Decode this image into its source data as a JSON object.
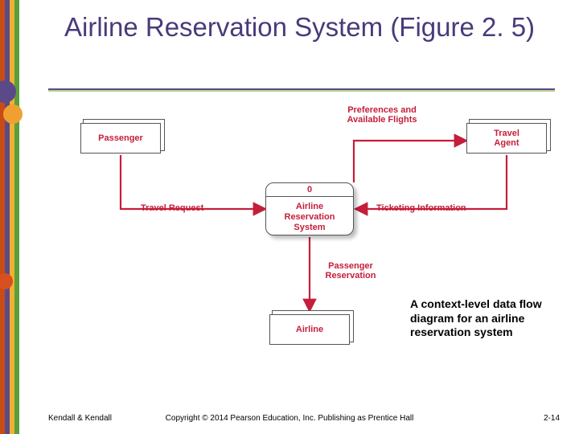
{
  "title": "Airline Reservation System (Figure 2. 5)",
  "entities": {
    "passenger": "Passenger",
    "travel_agent": "Travel\nAgent",
    "airline": "Airline"
  },
  "process": {
    "id": "0",
    "name": "Airline Reservation System"
  },
  "flows": {
    "travel_request": "Travel Request",
    "preferences": "Preferences and Available Flights",
    "ticketing": "Ticketing Information",
    "reservation": "Passenger Reservation"
  },
  "caption": "A context-level data flow diagram for an airline reservation system",
  "footer": {
    "left": "Kendall & Kendall",
    "center": "Copyright © 2014 Pearson Education, Inc. Publishing as Prentice Hall",
    "right": "2-14"
  }
}
